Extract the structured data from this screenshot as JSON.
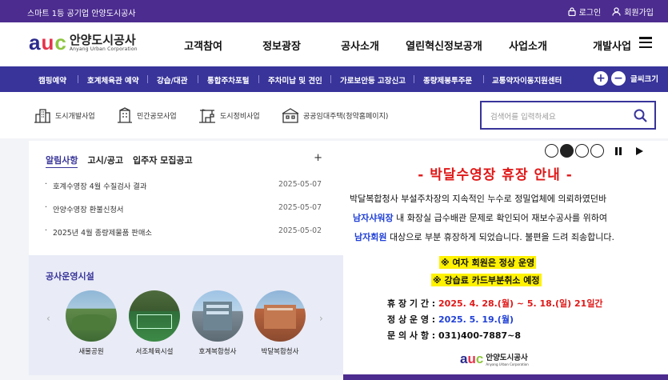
{
  "topbar": {
    "slogan": "스마트 1등 공기업 안양도시공사",
    "login": "로그인",
    "join": "회원가입"
  },
  "brand": {
    "logo_mark": "auc",
    "name_kr": "안양도시공사",
    "name_en": "Anyang Urban Corporation",
    "colors": {
      "a": "#2b2a8c",
      "u": "#e5324b",
      "c": "#8cc63f",
      "purple": "#4c2c8f",
      "navy": "#38349a"
    }
  },
  "gnb": [
    "고객참여",
    "정보광장",
    "공사소개",
    "열린혁신정보공개",
    "사업소개",
    "개발사업"
  ],
  "menu_icon": "hamburger-icon",
  "quick": {
    "items": [
      "캠핑예약",
      "호계체육관 예약",
      "강습/대관",
      "통합주차포털",
      "주차미납 및 견인",
      "가로보안등 고장신고",
      "종량제봉투주문",
      "교통약자이동지원센터"
    ],
    "zoom_in": "+",
    "zoom_out": "−",
    "font_label": "글씨크기"
  },
  "submenu": [
    {
      "icon": "city-icon",
      "label": "도시개발사업"
    },
    {
      "icon": "building-icon",
      "label": "민간공모사업"
    },
    {
      "icon": "crane-icon",
      "label": "도시정비사업"
    },
    {
      "icon": "house-icon",
      "label": "공공임대주택(청약홈페이지)"
    }
  ],
  "search": {
    "placeholder": "검색어를 입력하세요",
    "icon": "search-icon"
  },
  "notice": {
    "tabs": [
      "알림사항",
      "고시/공고",
      "입주자 모집공고"
    ],
    "more": "+",
    "items": [
      {
        "title": "호계수영장 4월 수질검사 결과",
        "date": "2025-05-07"
      },
      {
        "title": "안양수영장 환불신청서",
        "date": "2025-05-07"
      },
      {
        "title": "2025년 4월 종량제물품 판매소",
        "date": "2025-05-02"
      }
    ]
  },
  "facilities": {
    "title": "공사운영시설",
    "prev": "‹",
    "next": "›",
    "items": [
      "새물공원",
      "서조체육시설",
      "호계복합청사",
      "박달복합청사"
    ]
  },
  "popup": {
    "indicator_active": 2,
    "title": "- 박달수영장 휴장 안내 -",
    "line1": "박달복합청사 부설주차장의 지속적인 누수로 정밀업체에 의뢰하였던바",
    "line2_hl": "남자샤워장",
    "line2": " 내 화장실 급수배관 문제로 확인되어 재보수공사를 위하여",
    "line3_hl": "남자회원",
    "line3": " 대상으로 부분 휴장하게 되었습니다.   불편을 드려 죄송합니다.",
    "note1": "※ 여자 회원은 정상 운영",
    "note2": "※ 강습료 카드부분취소 예정",
    "period_label": "휴 장 기 간 : ",
    "period_value": "2025. 4. 28.(월)  ~  5. 18.(일) 21일간",
    "normal_label": "정 상 운 영 : ",
    "normal_value": "2025. 5. 19.(월)",
    "contact_label": "문 의 사 항 : ",
    "contact_value": "031)400-7887~8",
    "logo_kr": "안양도시공사",
    "logo_en": "Anyang Urban Corporation"
  }
}
